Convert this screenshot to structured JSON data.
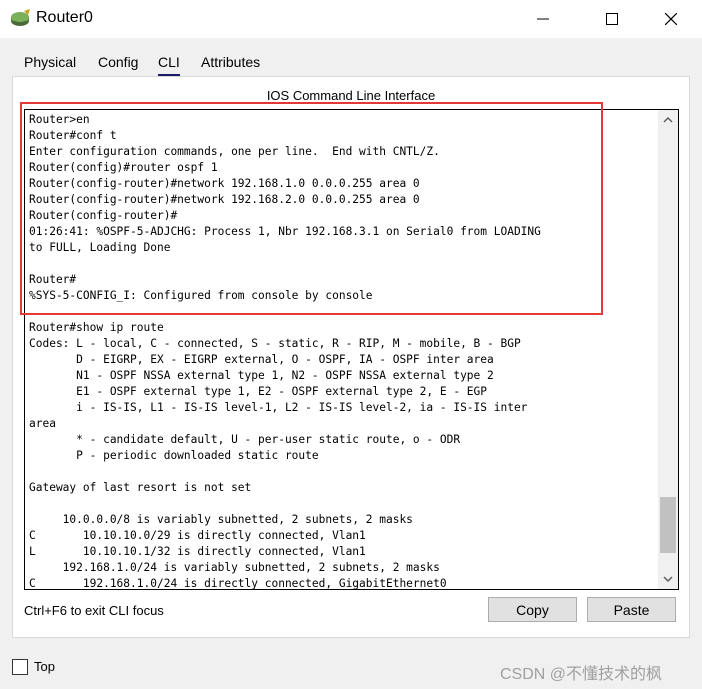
{
  "window": {
    "title": "Router0",
    "icon": "router-icon"
  },
  "tabs": [
    {
      "label": "Physical",
      "active": false
    },
    {
      "label": "Config",
      "active": false
    },
    {
      "label": "CLI",
      "active": true
    },
    {
      "label": "Attributes",
      "active": false
    }
  ],
  "panel": {
    "title": "IOS Command Line Interface"
  },
  "console": {
    "lines": [
      "Router>en",
      "Router#conf t",
      "Enter configuration commands, one per line.  End with CNTL/Z.",
      "Router(config)#router ospf 1",
      "Router(config-router)#network 192.168.1.0 0.0.0.255 area 0",
      "Router(config-router)#network 192.168.2.0 0.0.0.255 area 0",
      "Router(config-router)#",
      "01:26:41: %OSPF-5-ADJCHG: Process 1, Nbr 192.168.3.1 on Serial0 from LOADING",
      "to FULL, Loading Done",
      "",
      "Router#",
      "%SYS-5-CONFIG_I: Configured from console by console",
      "",
      "Router#show ip route",
      "Codes: L - local, C - connected, S - static, R - RIP, M - mobile, B - BGP",
      "       D - EIGRP, EX - EIGRP external, O - OSPF, IA - OSPF inter area",
      "       N1 - OSPF NSSA external type 1, N2 - OSPF NSSA external type 2",
      "       E1 - OSPF external type 1, E2 - OSPF external type 2, E - EGP",
      "       i - IS-IS, L1 - IS-IS level-1, L2 - IS-IS level-2, ia - IS-IS inter",
      "area",
      "       * - candidate default, U - per-user static route, o - ODR",
      "       P - periodic downloaded static route",
      "",
      "Gateway of last resort is not set",
      "",
      "     10.0.0.0/8 is variably subnetted, 2 subnets, 2 masks",
      "C       10.10.10.0/29 is directly connected, Vlan1",
      "L       10.10.10.1/32 is directly connected, Vlan1",
      "     192.168.1.0/24 is variably subnetted, 2 subnets, 2 masks",
      "C       192.168.1.0/24 is directly connected, GigabitEthernet0"
    ]
  },
  "footer": {
    "exit_hint": "Ctrl+F6 to exit CLI focus",
    "copy_label": "Copy",
    "paste_label": "Paste"
  },
  "bottom": {
    "top_checkbox_label": "Top",
    "top_checked": false,
    "watermark": "CSDN @不懂技术的枫"
  },
  "colors": {
    "highlight_border": "#e53935",
    "tab_underline": "#1a1a6a"
  }
}
